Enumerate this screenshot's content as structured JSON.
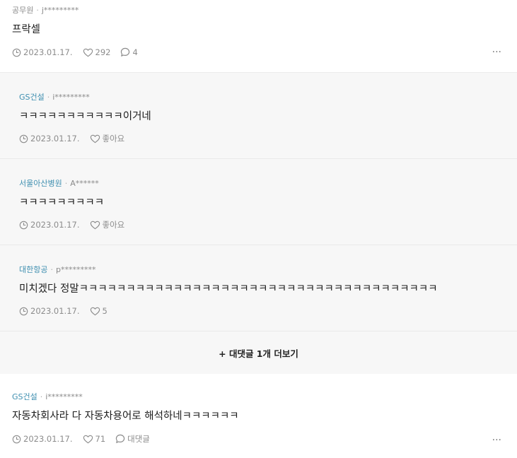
{
  "comments": [
    {
      "company": "공무원",
      "user": "j*********",
      "text": "프락셀",
      "date": "2023.01.17.",
      "likes": "292",
      "replies_count": "4"
    }
  ],
  "replies": [
    {
      "company": "GS건설",
      "user": "i*********",
      "text": "ㅋㅋㅋㅋㅋㅋㅋㅋㅋㅋㅋ이거네",
      "date": "2023.01.17.",
      "likes": "좋아요"
    },
    {
      "company": "서울아산병원",
      "user": "A******",
      "text": "ㅋㅋㅋㅋㅋㅋㅋㅋㅋ",
      "date": "2023.01.17.",
      "likes": "좋아요"
    },
    {
      "company": "대한항공",
      "user": "p*********",
      "text": "미치겠다 정말ㅋㅋㅋㅋㅋㅋㅋㅋㅋㅋㅋㅋㅋㅋㅋㅋㅋㅋㅋㅋㅋㅋㅋㅋㅋㅋㅋㅋㅋㅋㅋㅋㅋㅋㅋㅋㅋㅋ",
      "date": "2023.01.17.",
      "likes": "5"
    }
  ],
  "more_replies_label": "+ 대댓글 1개 더보기",
  "second_comment": {
    "company": "GS건설",
    "user": "i*********",
    "text": "자동차회사라 다 자동차용어로 해석하네ㅋㅋㅋㅋㅋㅋ",
    "date": "2023.01.17.",
    "likes": "71",
    "reply_label": "대댓글"
  },
  "dots_label": "···",
  "icons": {
    "clock": "clock-icon",
    "heart": "heart-icon",
    "speech_bubble": "comment-icon",
    "more": "more-options-icon"
  },
  "colors": {
    "company_link": "#3f8fb0",
    "muted": "#8a8a8a",
    "reply_bg": "#f7f7f7"
  }
}
